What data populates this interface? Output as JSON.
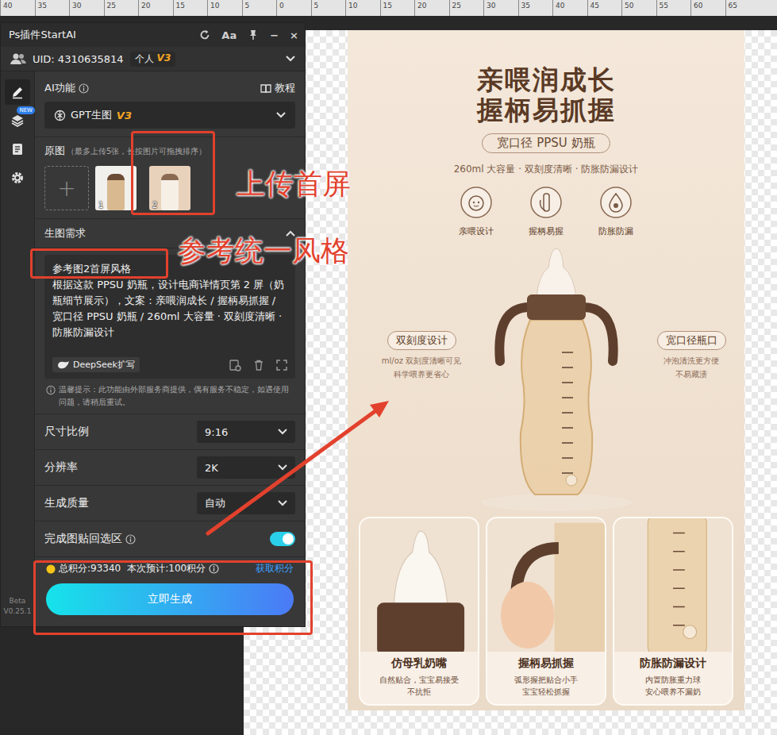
{
  "ruler": {
    "labels": [
      "40",
      "35",
      "30",
      "25",
      "20",
      "15",
      "10",
      "5",
      "0",
      "5",
      "10",
      "15",
      "20",
      "25",
      "30",
      "35",
      "40",
      "45",
      "50",
      "55",
      "60",
      "65"
    ]
  },
  "plugin": {
    "title": "Ps插件StartAI",
    "title_tools": [
      {
        "kind": "refresh",
        "label": ""
      },
      {
        "kind": "text",
        "label": "Aa"
      },
      {
        "kind": "pin",
        "label": ""
      },
      {
        "kind": "text",
        "label": "−"
      },
      {
        "kind": "text",
        "label": "×"
      }
    ],
    "uid": "UID: 4310635814",
    "account": {
      "label": "个人",
      "tier": "V3"
    },
    "sidebar": [
      {
        "kind": "pen",
        "selected": true,
        "badge": ""
      },
      {
        "kind": "layers",
        "selected": false,
        "badge": "NEW"
      },
      {
        "kind": "doc",
        "selected": false,
        "badge": ""
      },
      {
        "kind": "gear",
        "selected": false,
        "badge": ""
      }
    ],
    "version": {
      "stage": "Beta",
      "number": "V0.25.1"
    },
    "ai_function": {
      "label": "AI功能",
      "tutorial": "教程"
    },
    "model": {
      "name": "GPT生图",
      "tier": "V3"
    },
    "source": {
      "label": "原图",
      "hint": "（最多上传5张，长按图片可拖拽排序）",
      "add": "+",
      "thumbnails": [
        {
          "index": "1"
        },
        {
          "index": "2"
        }
      ]
    },
    "prompt": {
      "label": "生图需求",
      "expanded": true,
      "lines": [
        "参考图2首屏风格",
        "根据这款 PPSU 奶瓶，设计电商详情页第 2 屏（奶瓶细节展示），文案：亲喂润成长 / 握柄易抓握 / 宽口径 PPSU 奶瓶 / 260ml 大容量 · 双刻度清晰 · 防胀防漏设计"
      ],
      "expand_button": "DeepSeek扩写"
    },
    "notice": "温馨提示：此功能由外部服务商提供，偶有服务不稳定，如遇使用问题，请稍后重试。",
    "settings": [
      {
        "kind": "select",
        "label": "尺寸比例",
        "value": "9:16",
        "on": false
      },
      {
        "kind": "select",
        "label": "分辨率",
        "value": "2K",
        "on": false
      },
      {
        "kind": "select",
        "label": "生成质量",
        "value": "自动",
        "on": false
      },
      {
        "kind": "toggle",
        "label": "完成图贴回选区",
        "value": "",
        "on": true
      }
    ],
    "credits": {
      "total": "总积分:93340",
      "estimate": "本次预计:100积分",
      "link": "获取积分"
    },
    "generate_button": "立即生成"
  },
  "annotations": {
    "upload": "上传首屏",
    "style": "参考统一风格"
  },
  "design": {
    "title_lines": [
      "亲喂润成长",
      "握柄易抓握"
    ],
    "badge": "宽口径 PPSU 奶瓶",
    "subtitle": "260ml 大容量 · 双刻度清晰 · 防胀防漏设计",
    "features": [
      {
        "kind": "baby",
        "label": "亲喂设计"
      },
      {
        "kind": "hand",
        "label": "握柄易握"
      },
      {
        "kind": "drop",
        "label": "防胀防漏"
      }
    ],
    "callouts": [
      {
        "title": "双刻度设计",
        "lines": [
          "ml/oz 双刻度清晰可见",
          "科学喂养更省心"
        ]
      },
      {
        "title": "宽口径瓶口",
        "lines": [
          "冲泡清洗更方便",
          "不易藏渍"
        ]
      }
    ],
    "cards": [
      {
        "kind": "nipple",
        "title": "仿母乳奶嘴",
        "lines": [
          "自然贴合，宝宝易接受",
          "不抗拒"
        ]
      },
      {
        "kind": "handle",
        "title": "握柄易抓握",
        "lines": [
          "弧形握把贴合小手",
          "宝宝轻松抓握"
        ]
      },
      {
        "kind": "valve",
        "title": "防胀防漏设计",
        "lines": [
          "内置防胀重力球",
          "安心喂养不漏奶"
        ]
      }
    ]
  }
}
